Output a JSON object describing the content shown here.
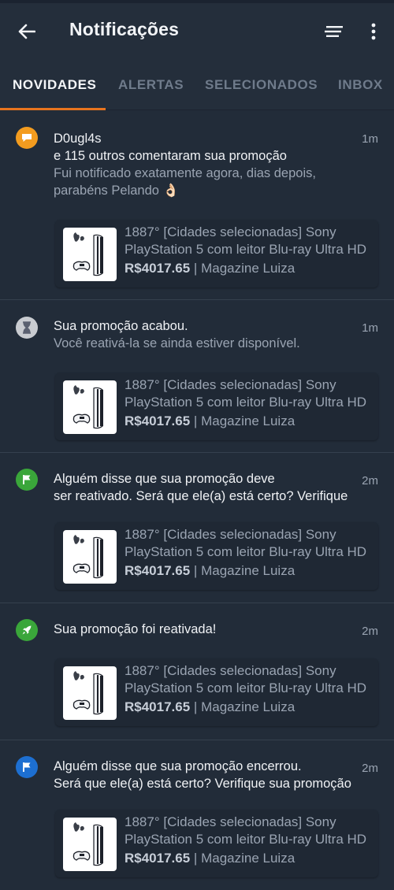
{
  "header": {
    "title": "Notificações",
    "back_icon": "arrow-left-icon",
    "filter_icon": "sort-lines-icon",
    "more_icon": "more-vertical-icon"
  },
  "tabs": [
    {
      "label": "NOVIDADES",
      "active": true
    },
    {
      "label": "ALERTAS",
      "active": false
    },
    {
      "label": "SELECIONADOS",
      "active": false
    },
    {
      "label": "INBOX",
      "active": false
    }
  ],
  "colors": {
    "accent": "#e8741e",
    "background": "#222c39",
    "badge_comment": "#f39c1f",
    "badge_expired": "#c9ccd1",
    "badge_flag_green": "#3aa63a",
    "badge_rocket": "#3aa63a",
    "badge_flag_blue": "#1d6fd1"
  },
  "notifications": [
    {
      "icon": "comment-icon",
      "user": "D0ugl4s",
      "line1": "e 115 outros comentaram sua promoção",
      "sub1": "Fui notificado exatamente agora, dias depois,",
      "sub2": "parabéns Pelando 👌🏻",
      "time": "1m",
      "deal": {
        "title1": "1887° [Cidades selecionadas] Sony",
        "title2": "PlayStation 5 com leitor Blu-ray Ultra HD",
        "price": "R$4017.65",
        "store": "Magazine Luiza"
      }
    },
    {
      "icon": "hourglass-icon",
      "line1": "Sua promoção acabou.",
      "sub1": "Você reativá-la se ainda estiver disponível.",
      "time": "1m",
      "deal": {
        "title1": "1887° [Cidades selecionadas] Sony",
        "title2": "PlayStation 5 com leitor Blu-ray Ultra HD",
        "price": "R$4017.65",
        "store": "Magazine Luiza"
      }
    },
    {
      "icon": "flag-icon",
      "line1": "Alguém disse que sua promoção deve",
      "line2": "ser reativado. Será que ele(a) está certo? Verifique",
      "time": "2m",
      "deal": {
        "title1": "1887° [Cidades selecionadas] Sony",
        "title2": "PlayStation 5 com leitor Blu-ray Ultra HD",
        "price": "R$4017.65",
        "store": "Magazine Luiza"
      }
    },
    {
      "icon": "rocket-icon",
      "line1": "Sua promoção foi reativada!",
      "time": "2m",
      "deal": {
        "title1": "1887° [Cidades selecionadas] Sony",
        "title2": "PlayStation 5 com leitor Blu-ray Ultra HD",
        "price": "R$4017.65",
        "store": "Magazine Luiza"
      }
    },
    {
      "icon": "flag-icon",
      "line1": "Alguém disse que sua promoção encerrou.",
      "line2": "Será que ele(a) está certo? Verifique sua promoção",
      "time": "2m",
      "deal": {
        "title1": "1887° [Cidades selecionadas] Sony",
        "title2": "PlayStation 5 com leitor Blu-ray Ultra HD",
        "price": "R$4017.65",
        "store": "Magazine Luiza"
      }
    }
  ]
}
